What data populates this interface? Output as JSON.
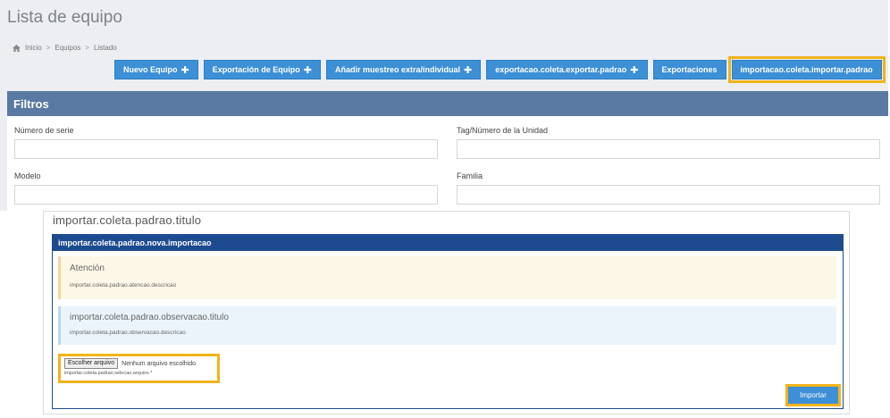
{
  "page": {
    "title": "Lista de equipo",
    "breadcrumb": [
      "Inicio",
      "Equipos",
      "Listado"
    ]
  },
  "actions": [
    {
      "label": "Nuevo Equipo",
      "plus": true
    },
    {
      "label": "Exportación de Equipo",
      "plus": true
    },
    {
      "label": "Añadir muestreo extra/individual",
      "plus": true
    },
    {
      "label": "exportacao.coleta.exportar.padrao",
      "plus": true
    },
    {
      "label": "Exportaciones",
      "plus": false
    },
    {
      "label": "importacao.coleta.importar.padrao",
      "plus": false
    }
  ],
  "filters": {
    "title": "Filtros",
    "fields": {
      "serial": "Número de serie",
      "tag": "Tag/Número de la Unidad",
      "model": "Modelo",
      "family": "Familia"
    }
  },
  "modal": {
    "outer_title": "importar.coleta.padrao.titulo",
    "header": "importar.coleta.padrao.nova.importacao",
    "warning": {
      "title": "Atención",
      "description": "importar.coleta.padrao.atencao.descricao"
    },
    "info": {
      "title": "importar.coleta.padrao.observacao.titulo",
      "description": "importar.coleta.padrao.observacao.descricao"
    },
    "file": {
      "button": "Escolher arquivo",
      "status": "Nenhum arquivo escolhido",
      "hint": "importar.coleta.padrao.selecao.arquivo *"
    },
    "import_button": "Importar"
  },
  "colors": {
    "primary_button": "#3d8fd6",
    "highlight_outline": "#f2b31b",
    "filters_header": "#5b7aa3",
    "modal_header": "#1e4b8f"
  }
}
